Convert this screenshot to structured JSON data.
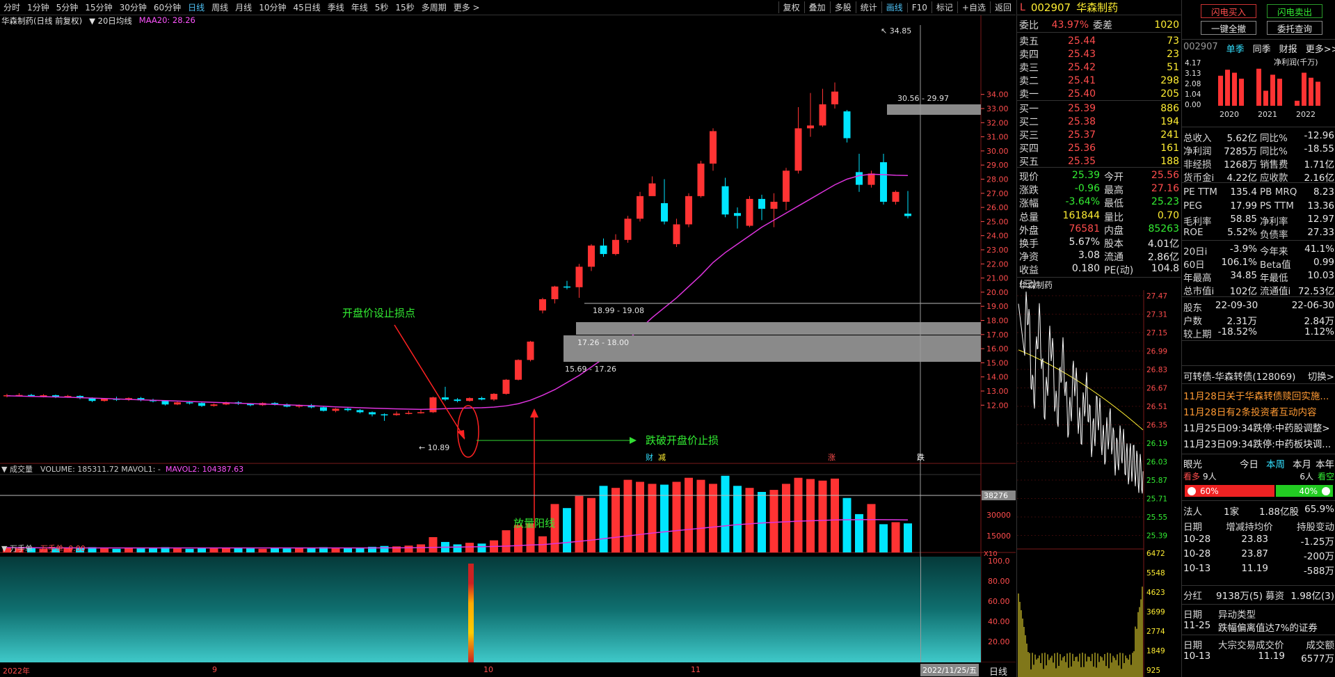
{
  "toolbar": {
    "timeframes": [
      "分时",
      "1分钟",
      "5分钟",
      "15分钟",
      "30分钟",
      "60分钟",
      "日线",
      "周线",
      "月线",
      "10分钟",
      "45日线",
      "季线",
      "年线",
      "5秒",
      "15秒",
      "多周期",
      "更多 >"
    ],
    "active_timeframe": "日线",
    "right_tools": [
      "复权",
      "叠加",
      "多股",
      "统计",
      "画线",
      "F10",
      "标记",
      "+自选",
      "返回"
    ],
    "active_tool": "画线"
  },
  "chart": {
    "title": "华森制药(日线 前复权)",
    "indicator_selector": "20日均线",
    "ma_label": "MAA20: 28.26",
    "price_axis": [
      "34.00",
      "33.00",
      "32.00",
      "31.00",
      "30.00",
      "29.00",
      "28.00",
      "27.00",
      "26.00",
      "25.00",
      "24.00",
      "23.00",
      "22.00",
      "21.00",
      "20.00",
      "19.00",
      "18.00",
      "17.00",
      "16.00",
      "15.00",
      "14.00",
      "13.00",
      "12.00"
    ],
    "annotations": {
      "stop_text": "开盘价设止损点",
      "break_text": "跌破开盘价止损",
      "volume_text": "放量阳线",
      "high_label": "34.85",
      "low_label": "10.89",
      "zone1": "30.56 - 29.97",
      "zone2": "18.99 - 19.08",
      "zone3": "17.26 - 18.00",
      "zone4": "15.69 - 17.26",
      "events": [
        "财",
        "减",
        "涨",
        "跌"
      ]
    },
    "date_axis": [
      "2022年",
      "9",
      "10",
      "11"
    ],
    "date_highlight": "2022/11/25/五"
  },
  "volume": {
    "label": "成交量",
    "values_label": "VOLUME: 185311.72  MAVOL1: -",
    "mavol2": "MAVOL2: 104387.63",
    "axis": [
      "38276",
      "30000",
      "15000"
    ],
    "unit": "X10"
  },
  "wanshou": {
    "label": "万手单",
    "value": "万手单: 0.00",
    "axis": [
      "100.0",
      "80.00",
      "60.00",
      "40.00",
      "20.00"
    ]
  },
  "period_label": "日线",
  "quote": {
    "header_l": "L",
    "code": "002907",
    "name": "华森制药",
    "weibi_label": "委比",
    "weibi": "43.97%",
    "weicha_label": "委差",
    "weicha": "1020",
    "asks": [
      {
        "label": "卖五",
        "price": "25.44",
        "vol": "73"
      },
      {
        "label": "卖四",
        "price": "25.43",
        "vol": "23"
      },
      {
        "label": "卖三",
        "price": "25.42",
        "vol": "51"
      },
      {
        "label": "卖二",
        "price": "25.41",
        "vol": "298"
      },
      {
        "label": "卖一",
        "price": "25.40",
        "vol": "205"
      }
    ],
    "bids": [
      {
        "label": "买一",
        "price": "25.39",
        "vol": "886"
      },
      {
        "label": "买二",
        "price": "25.38",
        "vol": "194"
      },
      {
        "label": "买三",
        "price": "25.37",
        "vol": "241"
      },
      {
        "label": "买四",
        "price": "25.36",
        "vol": "161"
      },
      {
        "label": "买五",
        "price": "25.35",
        "vol": "188"
      }
    ],
    "stats": [
      {
        "k": "现价",
        "v": "25.39",
        "vc": "grn",
        "k2": "今开",
        "v2": "25.56",
        "v2c": "red"
      },
      {
        "k": "涨跌",
        "v": "-0.96",
        "vc": "grn",
        "k2": "最高",
        "v2": "27.16",
        "v2c": "red"
      },
      {
        "k": "涨幅",
        "v": "-3.64%",
        "vc": "grn",
        "k2": "最低",
        "v2": "25.23",
        "v2c": "grn"
      },
      {
        "k": "总量",
        "v": "161844",
        "vc": "yel",
        "k2": "量比",
        "v2": "0.70",
        "v2c": "yel"
      },
      {
        "k": "外盘",
        "v": "76581",
        "vc": "red",
        "k2": "内盘",
        "v2": "85263",
        "v2c": "grn"
      },
      {
        "k": "换手",
        "v": "5.67%",
        "vc": "wht",
        "k2": "股本",
        "v2": "4.01亿",
        "v2c": "wht"
      },
      {
        "k": "净资",
        "v": "3.08",
        "vc": "wht",
        "k2": "流通",
        "v2": "2.86亿",
        "v2c": "wht"
      },
      {
        "k": "收益(三)",
        "v": "0.180",
        "vc": "wht",
        "k2": "PE(动)",
        "v2": "104.8",
        "v2c": "wht"
      }
    ],
    "minute_title": "华森制药",
    "minute_axis_left": [
      "27.47",
      "27.31",
      "27.15",
      "26.99",
      "26.83",
      "26.67",
      "26.51",
      "26.35",
      "26.19",
      "26.03",
      "25.87",
      "25.71",
      "25.55",
      "25.39"
    ],
    "minute_vol_axis": [
      "6472",
      "5548",
      "4623",
      "3699",
      "2774",
      "1849",
      "925"
    ]
  },
  "fin": {
    "buy_btn": "闪电买入",
    "sell_btn": "闪电卖出",
    "cancel_btn": "一键全撤",
    "query_btn": "委托查询",
    "code": "002907",
    "tabs": [
      "单季",
      "同季",
      "财报",
      "更多>>"
    ],
    "profit_label": "净利润(千万)",
    "bar_axis": [
      "4.17",
      "3.13",
      "2.08",
      "1.04",
      "0.00"
    ],
    "years": [
      "2020",
      "2021",
      "2022"
    ],
    "rows": [
      {
        "k": "总收入",
        "v": "5.62亿",
        "k2": "同比%",
        "v2": "-12.96"
      },
      {
        "k": "净利润",
        "v": "7285万",
        "k2": "同比%",
        "v2": "-18.55"
      },
      {
        "k": "非经损",
        "v": "1268万",
        "k2": "销售费",
        "v2": "1.71亿"
      },
      {
        "k": "货币金i",
        "v": "4.22亿",
        "k2": "应收款",
        "v2": "2.16亿"
      },
      {
        "k": "PE TTM",
        "v": "135.4",
        "k2": "PB MRQ",
        "v2": "8.23"
      },
      {
        "k": "PEG",
        "v": "17.99",
        "k2": "PS TTM",
        "v2": "13.36"
      },
      {
        "k": "毛利率",
        "v": "58.85",
        "k2": "净利率",
        "v2": "12.97"
      },
      {
        "k": "ROE",
        "v": "5.52%",
        "k2": "负债率",
        "v2": "27.33"
      },
      {
        "k": "20日i",
        "v": "-3.9%",
        "k2": "今年来",
        "v2": "41.1%"
      },
      {
        "k": "60日",
        "v": "106.1%",
        "k2": "Beta值",
        "v2": "0.99"
      },
      {
        "k": "年最高",
        "v": "34.85",
        "k2": "年最低",
        "v2": "10.03"
      },
      {
        "k": "总市值i",
        "v": "102亿",
        "k2": "流通值i",
        "v2": "72.53亿"
      },
      {
        "k": "股东",
        "v": "22-09-30",
        "k2": "",
        "v2": "22-06-30"
      },
      {
        "k": "户数",
        "v": "2.31万",
        "k2": "",
        "v2": "2.84万"
      },
      {
        "k": "较上期",
        "v": "-18.52%",
        "k2": "",
        "v2": "1.12%"
      }
    ],
    "bond_label": "可转债-华森转债(128069)",
    "bond_action": "切换>",
    "news": [
      {
        "text": "11月28日关于华森转债赎回实施...",
        "c": "or"
      },
      {
        "text": "11月28日有2条投资者互动内容",
        "c": "or"
      },
      {
        "text": "11月25日09:34跌停:中药股调整>",
        "c": "wht"
      },
      {
        "text": "11月23日09:34跌停:中药板块调...",
        "c": "wht"
      }
    ],
    "vision_label": "眼光",
    "vision_tabs": [
      "今日",
      "本周",
      "本月",
      "本年"
    ],
    "bull_label": "看多",
    "bull_count": "9人",
    "bear_count": "6人",
    "bear_label": "看空",
    "bull_pct": "60%",
    "bear_pct": "40%",
    "org_label": "法人",
    "org_count": "1家",
    "org_shares": "1.88亿股",
    "org_pct": "65.9%",
    "hold_head": [
      "日期",
      "增减持均价",
      "持股变动"
    ],
    "holds": [
      [
        "10-28",
        "23.83",
        "-1.25万"
      ],
      [
        "10-28",
        "23.87",
        "-200万"
      ],
      [
        "10-13",
        "11.19",
        "-588万"
      ]
    ],
    "dividend": {
      "k": "分红",
      "v": "9138万(5)",
      "k2": "募资",
      "v2": "1.98亿(3)"
    },
    "abn_head": [
      "日期",
      "异动类型"
    ],
    "abn_row": [
      "11-25",
      "跌幅偏离值达7%的证券"
    ],
    "block_head": [
      "日期",
      "大宗交易成交价",
      "成交额"
    ],
    "block_row": [
      "10-13",
      "11.19",
      "6577万"
    ]
  },
  "chart_data": {
    "type": "candlestick",
    "candles": [
      [
        12.65,
        12.7,
        12.8,
        12.55
      ],
      [
        12.7,
        12.72,
        12.85,
        12.6
      ],
      [
        12.72,
        12.65,
        12.8,
        12.58
      ],
      [
        12.65,
        12.7,
        12.78,
        12.55
      ],
      [
        12.7,
        12.6,
        12.75,
        12.5
      ],
      [
        12.6,
        12.65,
        12.72,
        12.52
      ],
      [
        12.65,
        12.5,
        12.7,
        12.42
      ],
      [
        12.5,
        12.3,
        12.55,
        12.22
      ],
      [
        12.3,
        12.45,
        12.5,
        12.25
      ],
      [
        12.45,
        12.38,
        12.6,
        12.3
      ],
      [
        12.38,
        12.5,
        12.55,
        12.3
      ],
      [
        12.5,
        12.35,
        12.58,
        12.28
      ],
      [
        12.35,
        12.3,
        12.45,
        12.2
      ],
      [
        12.3,
        12.05,
        12.35,
        11.98
      ],
      [
        12.05,
        12.2,
        12.25,
        12.0
      ],
      [
        12.2,
        12.15,
        12.3,
        12.05
      ],
      [
        12.15,
        11.95,
        12.2,
        11.88
      ],
      [
        11.95,
        12.05,
        12.12,
        11.9
      ],
      [
        12.05,
        12.2,
        12.25,
        12.0
      ],
      [
        12.2,
        12.1,
        12.28,
        12.02
      ],
      [
        12.1,
        12.0,
        12.15,
        11.92
      ],
      [
        12.0,
        12.15,
        12.2,
        11.95
      ],
      [
        12.15,
        12.05,
        12.22,
        11.98
      ],
      [
        12.05,
        11.9,
        12.12,
        11.85
      ],
      [
        11.9,
        12.0,
        12.05,
        11.8
      ],
      [
        12.0,
        11.85,
        12.08,
        11.78
      ],
      [
        11.85,
        11.6,
        11.9,
        11.55
      ],
      [
        11.6,
        11.75,
        11.8,
        11.5
      ],
      [
        11.75,
        11.65,
        11.82,
        11.55
      ],
      [
        11.65,
        11.5,
        11.72,
        11.42
      ],
      [
        11.5,
        11.35,
        11.55,
        11.2
      ],
      [
        11.35,
        11.3,
        11.42,
        10.89
      ],
      [
        11.3,
        11.4,
        11.55,
        11.25
      ],
      [
        11.4,
        11.45,
        11.6,
        11.35
      ],
      [
        11.45,
        11.5,
        11.7,
        11.4
      ],
      [
        11.5,
        12.55,
        12.6,
        11.45
      ],
      [
        12.55,
        12.4,
        13.3,
        12.3
      ],
      [
        12.4,
        12.3,
        12.5,
        12.2
      ],
      [
        12.3,
        12.5,
        12.55,
        12.25
      ],
      [
        12.5,
        12.4,
        12.6,
        12.35
      ],
      [
        12.4,
        12.8,
        12.85,
        12.3
      ],
      [
        12.8,
        13.8,
        13.85,
        12.75
      ],
      [
        13.8,
        15.2,
        15.25,
        13.75
      ],
      [
        15.2,
        16.5,
        16.55,
        15.1
      ],
      [
        18.7,
        19.5,
        19.6,
        18.5
      ],
      [
        19.5,
        20.4,
        20.45,
        19.2
      ],
      [
        20.4,
        20.35,
        20.8,
        20.2
      ],
      [
        20.35,
        21.8,
        22.0,
        19.6
      ],
      [
        21.8,
        23.3,
        23.4,
        21.5
      ],
      [
        23.3,
        22.7,
        23.8,
        22.5
      ],
      [
        22.7,
        23.7,
        24.1,
        22.6
      ],
      [
        23.7,
        25.2,
        25.4,
        23.5
      ],
      [
        25.2,
        26.8,
        27.1,
        25.0
      ],
      [
        26.8,
        27.7,
        28.2,
        27.0
      ],
      [
        26.3,
        25.0,
        28.0,
        24.8
      ],
      [
        23.4,
        24.8,
        25.2,
        23.2
      ],
      [
        24.8,
        26.8,
        27.0,
        24.6
      ],
      [
        26.8,
        29.1,
        29.3,
        26.7
      ],
      [
        29.1,
        31.4,
        31.6,
        28.6
      ],
      [
        27.5,
        25.5,
        28.1,
        25.3
      ],
      [
        25.6,
        25.4,
        26.0,
        24.5
      ],
      [
        24.7,
        26.6,
        26.8,
        24.6
      ],
      [
        26.6,
        25.9,
        26.9,
        25.1
      ],
      [
        25.9,
        26.4,
        27.0,
        24.6
      ],
      [
        26.4,
        28.6,
        28.8,
        25.8
      ],
      [
        28.6,
        31.6,
        33.1,
        28.4
      ],
      [
        31.6,
        31.8,
        34.1,
        31.0
      ],
      [
        31.8,
        33.3,
        34.4,
        31.7
      ],
      [
        33.3,
        34.2,
        34.85,
        33.0
      ],
      [
        32.8,
        30.9,
        32.9,
        30.6
      ],
      [
        28.5,
        27.6,
        29.8,
        27.1
      ],
      [
        27.6,
        28.4,
        28.6,
        27.4
      ],
      [
        29.2,
        26.4,
        29.8,
        26.2
      ],
      [
        26.4,
        27.1,
        27.2,
        26.2
      ],
      [
        25.56,
        25.39,
        27.16,
        25.23
      ]
    ],
    "ma20": [
      12.66,
      12.64,
      12.62,
      12.6,
      12.58,
      12.56,
      12.53,
      12.5,
      12.47,
      12.44,
      12.41,
      12.38,
      12.35,
      12.32,
      12.29,
      12.26,
      12.23,
      12.2,
      12.17,
      12.14,
      12.11,
      12.08,
      12.05,
      12.02,
      11.99,
      11.96,
      11.92,
      11.88,
      11.85,
      11.82,
      11.79,
      11.76,
      11.74,
      11.72,
      11.7,
      11.72,
      11.75,
      11.78,
      11.8,
      11.82,
      11.86,
      11.95,
      12.1,
      12.35,
      12.7,
      13.1,
      13.6,
      14.1,
      14.7,
      15.3,
      15.95,
      16.65,
      17.4,
      18.2,
      18.9,
      19.6,
      20.4,
      21.2,
      22.1,
      22.8,
      23.4,
      24.0,
      24.6,
      25.1,
      25.6,
      26.1,
      26.6,
      27.1,
      27.6,
      28.0,
      28.25,
      28.35,
      28.32,
      28.28,
      28.26
    ],
    "volume": [
      1.2,
      1.0,
      1.1,
      0.9,
      1.0,
      1.2,
      1.1,
      1.3,
      1.0,
      0.9,
      1.2,
      1.0,
      1.1,
      1.3,
      1.0,
      0.9,
      1.1,
      1.0,
      1.2,
      1.1,
      1.0,
      0.9,
      1.1,
      1.0,
      1.2,
      1.1,
      1.3,
      1.0,
      1.2,
      1.1,
      1.4,
      1.6,
      1.5,
      1.7,
      2.0,
      3.8,
      2.6,
      2.0,
      2.4,
      2.2,
      3.0,
      5.5,
      6.8,
      7.2,
      4.0,
      12.0,
      11.0,
      14.0,
      13.5,
      16.5,
      16.0,
      18.0,
      17.5,
      17.0,
      16.8,
      17.5,
      18.5,
      18.0,
      17.0,
      19.0,
      16.5,
      16.0,
      15.0,
      15.5,
      17.0,
      18.5,
      18.2,
      17.8,
      18.3,
      13.5,
      9.5,
      12.0,
      7.0,
      7.5,
      7.2
    ],
    "mavol2": [
      1.2,
      1.18,
      1.16,
      1.15,
      1.14,
      1.14,
      1.13,
      1.13,
      1.12,
      1.12,
      1.12,
      1.12,
      1.12,
      1.12,
      1.12,
      1.11,
      1.11,
      1.11,
      1.11,
      1.11,
      1.11,
      1.11,
      1.11,
      1.11,
      1.11,
      1.12,
      1.12,
      1.12,
      1.12,
      1.12,
      1.13,
      1.14,
      1.15,
      1.17,
      1.19,
      1.25,
      1.3,
      1.34,
      1.38,
      1.42,
      1.48,
      1.58,
      1.7,
      1.85,
      1.95,
      2.2,
      2.45,
      2.75,
      3.05,
      3.4,
      3.75,
      4.1,
      4.45,
      4.8,
      5.1,
      5.4,
      5.7,
      6.0,
      6.3,
      6.6,
      6.9,
      7.1,
      7.3,
      7.45,
      7.6,
      7.75,
      7.85,
      7.95,
      8.05,
      8.1,
      8.12,
      8.14,
      8.12,
      8.1,
      8.05
    ]
  },
  "colors": {
    "up": "#ff3333",
    "down": "#00e5ff",
    "ma": "#dd33dd",
    "bg": "#000000",
    "accent": "#ffee33"
  }
}
